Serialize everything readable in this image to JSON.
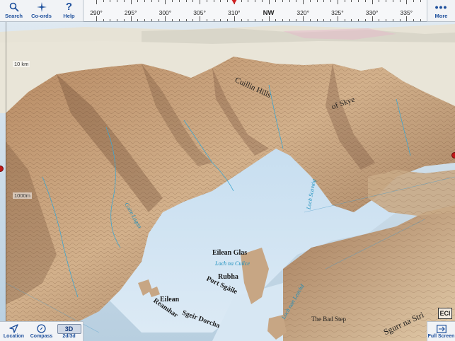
{
  "toolbar": {
    "search_label": "Search",
    "coords_label": "Co-ords",
    "help_label": "Help",
    "more_label": "More"
  },
  "bearing": {
    "ticks": [
      "290°",
      "295°",
      "300°",
      "305°",
      "310°",
      "NW",
      "320°",
      "325°",
      "330°",
      "335°"
    ],
    "current": "310°"
  },
  "scale": {
    "top_label": "10 km",
    "mid_label": "1000m"
  },
  "map_labels": {
    "cuillin": "Cuillin Hills",
    "skye": "of Skye",
    "loch_scavaig": "Loch Scavaig",
    "eilean_glas": "Eilean Glas",
    "loch_na_cuilce": "Loch na Cuilce",
    "rubha_port": "Rubha",
    "port_sgaile": "Port Sgàile",
    "eilean_reamhar": "Eilean",
    "reamhar": "Reamhar",
    "sgeir_dorcha": "Sgeir Dorcha",
    "loch_nan_leachd": "Loch nan Leachd",
    "bad_step": "The Bad Step",
    "sgurr_na_stri": "Sgurr na Stri",
    "lag_a_bhaird": "Coire Lagan"
  },
  "bottom": {
    "location_label": "Location",
    "compass_label": "Compass",
    "mode_label": "2d/3d",
    "mode_value": "3D",
    "fullscreen_label": "Full Screen"
  },
  "ecl_label": "ECl"
}
